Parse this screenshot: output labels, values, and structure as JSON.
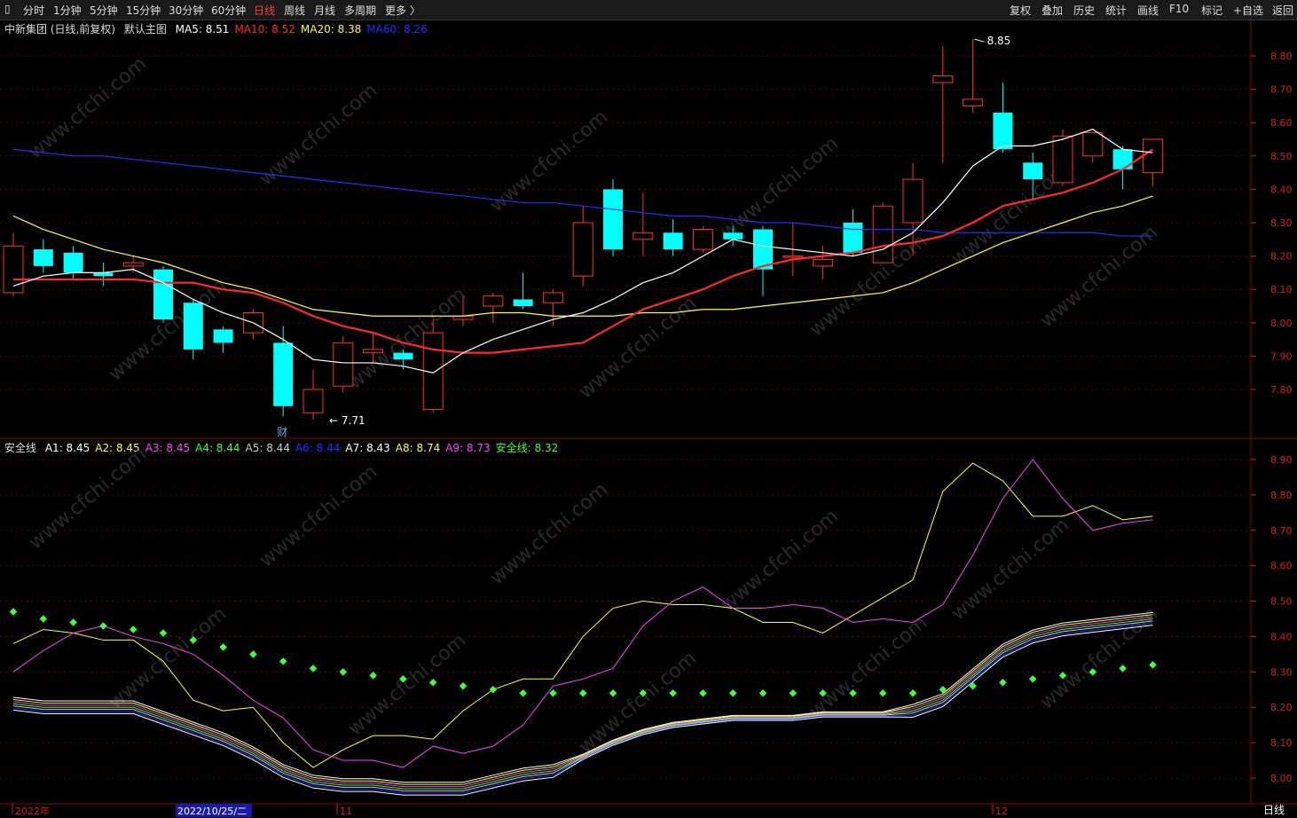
{
  "toolbar": {
    "left": [
      "分时",
      "1分钟",
      "5分钟",
      "15分钟",
      "30分钟",
      "60分钟",
      "日线",
      "周线",
      "月线",
      "多周期",
      "更多 〉"
    ],
    "active": "日线",
    "right": [
      "复权",
      "叠加",
      "历史",
      "统计",
      "画线",
      "F10",
      "标记",
      "+自选",
      "返回"
    ]
  },
  "main_panel": {
    "stock": "中新集团 (日线,前复权)",
    "template": "默认主图",
    "ma": [
      {
        "label": "MA5:",
        "value": "8.51",
        "color": "#ffffff"
      },
      {
        "label": "MA10:",
        "value": "8.52",
        "color": "#ff2a2a"
      },
      {
        "label": "MA20:",
        "value": "8.38",
        "color": "#ffff40"
      },
      {
        "label": "MA60:",
        "value": "8.26",
        "color": "#2a2aff"
      }
    ],
    "high_label": "8.85",
    "low_label": "7.71",
    "marker": "财",
    "y_ticks": [
      "8.80",
      "8.70",
      "8.60",
      "8.50",
      "8.40",
      "8.30",
      "8.20",
      "8.10",
      "8.00",
      "7.90",
      "7.80"
    ]
  },
  "sub_panel": {
    "name": "安全线",
    "lines": [
      {
        "label": "A1:",
        "value": "8.45",
        "color": "#ffffff"
      },
      {
        "label": "A2:",
        "value": "8.45",
        "color": "#ffff40"
      },
      {
        "label": "A3:",
        "value": "8.45",
        "color": "#ff40ff"
      },
      {
        "label": "A4:",
        "value": "8.44",
        "color": "#40ff40"
      },
      {
        "label": "A5:",
        "value": "8.44",
        "color": "#cccccc"
      },
      {
        "label": "A6:",
        "value": "8.44",
        "color": "#2a2aff"
      },
      {
        "label": "A7:",
        "value": "8.43",
        "color": "#ffffff"
      },
      {
        "label": "A8:",
        "value": "8.74",
        "color": "#ffff40"
      },
      {
        "label": "A9:",
        "value": "8.73",
        "color": "#ff40ff"
      },
      {
        "label": "安全线:",
        "value": "8.32",
        "color": "#40ff40"
      }
    ],
    "y_ticks": [
      "8.90",
      "8.80",
      "8.70",
      "8.60",
      "8.50",
      "8.40",
      "8.30",
      "8.20",
      "8.10",
      "8.00"
    ]
  },
  "x_axis": {
    "labels": [
      "2022年",
      "2022/10/25/二",
      "11",
      "12"
    ],
    "period": "日线"
  },
  "chart_data": {
    "type": "candlestick",
    "ylim_main": [
      7.68,
      8.88
    ],
    "ylim_sub": [
      7.98,
      8.93
    ],
    "candles": [
      [
        8.09,
        8.23,
        8.27,
        8.08
      ],
      [
        8.22,
        8.17,
        8.25,
        8.15
      ],
      [
        8.21,
        8.15,
        8.23,
        8.13
      ],
      [
        8.15,
        8.14,
        8.18,
        8.11
      ],
      [
        8.17,
        8.18,
        8.2,
        8.15
      ],
      [
        8.16,
        8.01,
        8.17,
        8.0
      ],
      [
        8.06,
        7.92,
        8.07,
        7.89
      ],
      [
        7.98,
        7.94,
        7.99,
        7.91
      ],
      [
        7.97,
        8.03,
        8.04,
        7.95
      ],
      [
        7.94,
        7.75,
        7.99,
        7.72
      ],
      [
        7.73,
        7.8,
        7.86,
        7.71
      ],
      [
        7.81,
        7.94,
        7.96,
        7.79
      ],
      [
        7.91,
        7.92,
        7.97,
        7.88
      ],
      [
        7.91,
        7.89,
        7.92,
        7.86
      ],
      [
        7.74,
        7.97,
        8.01,
        7.73
      ],
      [
        8.01,
        8.02,
        8.08,
        7.99
      ],
      [
        8.05,
        8.08,
        8.09,
        8.0
      ],
      [
        8.07,
        8.05,
        8.15,
        8.04
      ],
      [
        8.06,
        8.09,
        8.1,
        7.99
      ],
      [
        8.14,
        8.3,
        8.35,
        8.11
      ],
      [
        8.4,
        8.22,
        8.43,
        8.2
      ],
      [
        8.25,
        8.27,
        8.39,
        8.2
      ],
      [
        8.27,
        8.22,
        8.31,
        8.2
      ],
      [
        8.22,
        8.28,
        8.29,
        8.21
      ],
      [
        8.27,
        8.25,
        8.29,
        8.23
      ],
      [
        8.28,
        8.16,
        8.29,
        8.08
      ],
      [
        8.2,
        8.2,
        8.3,
        8.14
      ],
      [
        8.17,
        8.19,
        8.23,
        8.13
      ],
      [
        8.3,
        8.21,
        8.34,
        8.2
      ],
      [
        8.18,
        8.35,
        8.36,
        8.18
      ],
      [
        8.3,
        8.43,
        8.48,
        8.2
      ],
      [
        8.72,
        8.74,
        8.83,
        8.48
      ],
      [
        8.65,
        8.67,
        8.85,
        8.63
      ],
      [
        8.63,
        8.52,
        8.72,
        8.51
      ],
      [
        8.48,
        8.43,
        8.51,
        8.37
      ],
      [
        8.42,
        8.56,
        8.58,
        8.41
      ],
      [
        8.5,
        8.57,
        8.57,
        8.48
      ],
      [
        8.52,
        8.46,
        8.53,
        8.4
      ],
      [
        8.45,
        8.55,
        8.55,
        8.41
      ]
    ],
    "ma5": [
      8.11,
      8.14,
      8.15,
      8.15,
      8.16,
      8.12,
      8.07,
      8.03,
      8.0,
      7.95,
      7.89,
      7.88,
      7.88,
      7.87,
      7.85,
      7.91,
      7.95,
      7.98,
      8.01,
      8.03,
      8.07,
      8.12,
      8.15,
      8.2,
      8.25,
      8.23,
      8.22,
      8.21,
      8.2,
      8.22,
      8.27,
      8.36,
      8.47,
      8.53,
      8.53,
      8.55,
      8.58,
      8.52,
      8.51
    ],
    "ma10": [
      8.13,
      8.13,
      8.13,
      8.13,
      8.13,
      8.12,
      8.12,
      8.1,
      8.09,
      8.06,
      8.02,
      7.99,
      7.97,
      7.94,
      7.92,
      7.91,
      7.91,
      7.92,
      7.93,
      7.94,
      7.99,
      8.04,
      8.07,
      8.1,
      8.14,
      8.17,
      8.19,
      8.2,
      8.21,
      8.23,
      8.24,
      8.26,
      8.3,
      8.35,
      8.37,
      8.39,
      8.42,
      8.46,
      8.52
    ],
    "ma20": [
      8.32,
      8.28,
      8.25,
      8.22,
      8.2,
      8.18,
      8.15,
      8.12,
      8.1,
      8.07,
      8.04,
      8.03,
      8.02,
      8.02,
      8.02,
      8.02,
      8.03,
      8.03,
      8.02,
      8.02,
      8.02,
      8.03,
      8.03,
      8.04,
      8.04,
      8.05,
      8.06,
      8.07,
      8.08,
      8.09,
      8.12,
      8.16,
      8.2,
      8.24,
      8.27,
      8.3,
      8.33,
      8.35,
      8.38
    ],
    "ma60": [
      8.52,
      8.51,
      8.5,
      8.5,
      8.49,
      8.48,
      8.47,
      8.46,
      8.45,
      8.44,
      8.43,
      8.42,
      8.41,
      8.4,
      8.39,
      8.38,
      8.37,
      8.36,
      8.36,
      8.35,
      8.34,
      8.33,
      8.32,
      8.32,
      8.31,
      8.3,
      8.3,
      8.29,
      8.28,
      8.28,
      8.28,
      8.27,
      8.27,
      8.27,
      8.27,
      8.27,
      8.27,
      8.26,
      8.26
    ],
    "a8": [
      8.38,
      8.42,
      8.41,
      8.39,
      8.39,
      8.33,
      8.22,
      8.19,
      8.2,
      8.1,
      8.03,
      8.08,
      8.12,
      8.12,
      8.11,
      8.19,
      8.25,
      8.28,
      8.28,
      8.4,
      8.48,
      8.5,
      8.49,
      8.49,
      8.48,
      8.44,
      8.44,
      8.41,
      8.46,
      8.51,
      8.56,
      8.81,
      8.89,
      8.84,
      8.74,
      8.74,
      8.77,
      8.73,
      8.74
    ],
    "a9": [
      8.3,
      8.36,
      8.41,
      8.43,
      8.4,
      8.38,
      8.35,
      8.29,
      8.22,
      8.17,
      8.08,
      8.05,
      8.05,
      8.03,
      8.09,
      8.07,
      8.09,
      8.15,
      8.26,
      8.28,
      8.31,
      8.43,
      8.5,
      8.54,
      8.48,
      8.48,
      8.49,
      8.48,
      8.44,
      8.45,
      8.44,
      8.49,
      8.63,
      8.79,
      8.9,
      8.79,
      8.7,
      8.72,
      8.73
    ],
    "a_mid": [
      8.21,
      8.2,
      8.2,
      8.2,
      8.2,
      8.17,
      8.14,
      8.11,
      8.07,
      8.02,
      7.99,
      7.98,
      7.98,
      7.97,
      7.97,
      7.97,
      7.99,
      8.01,
      8.02,
      8.06,
      8.1,
      8.13,
      8.15,
      8.16,
      8.17,
      8.17,
      8.17,
      8.18,
      8.18,
      8.18,
      8.19,
      8.22,
      8.29,
      8.36,
      8.4,
      8.42,
      8.43,
      8.44,
      8.45
    ],
    "safe_line": [
      8.47,
      8.45,
      8.44,
      8.43,
      8.42,
      8.41,
      8.39,
      8.37,
      8.35,
      8.33,
      8.31,
      8.3,
      8.29,
      8.28,
      8.27,
      8.26,
      8.25,
      8.24,
      8.24,
      8.24,
      8.24,
      8.24,
      8.24,
      8.24,
      8.24,
      8.24,
      8.24,
      8.24,
      8.24,
      8.24,
      8.24,
      8.25,
      8.26,
      8.27,
      8.28,
      8.29,
      8.3,
      8.31,
      8.32
    ]
  }
}
